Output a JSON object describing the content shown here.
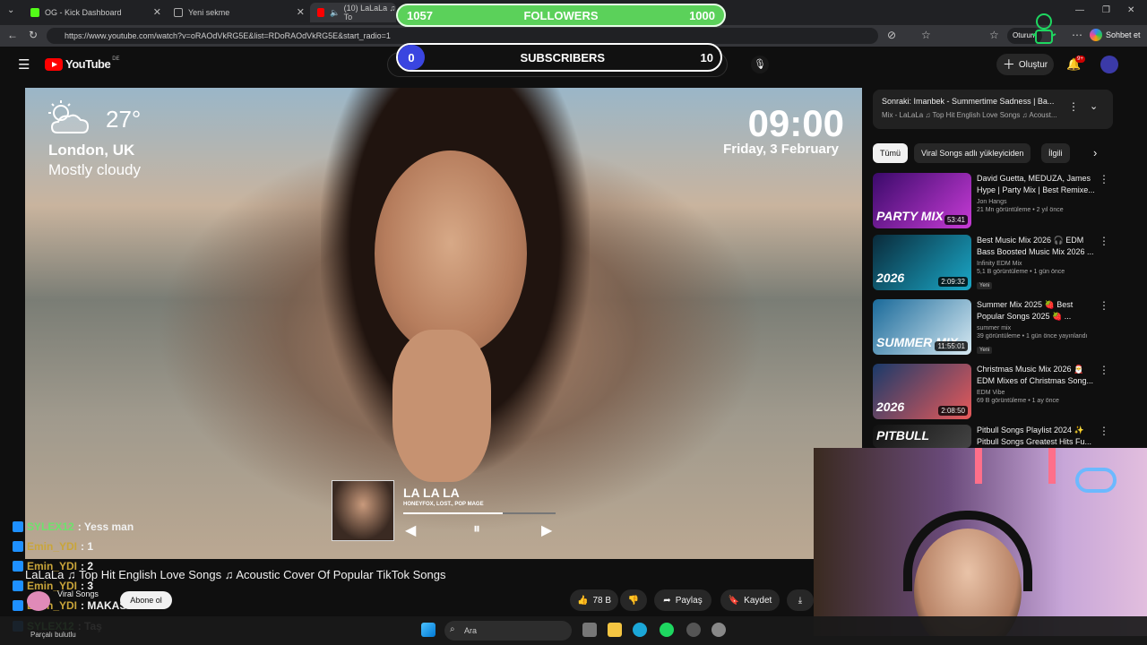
{
  "browser": {
    "tabs": [
      {
        "label": "OG - Kick Dashboard",
        "active": false
      },
      {
        "label": "Yeni sekme",
        "active": false
      },
      {
        "label": "(10) LaLaLa ♫ To",
        "active": true
      }
    ],
    "url": "https://www.youtube.com/watch?v=oRAOdVkRG5E&list=RDoRAOdVkRG5E&start_radio=1",
    "profile_label": "Oturum",
    "copilot_label": "Sohbet et"
  },
  "overlay": {
    "followers": {
      "current": "1057",
      "label": "FOLLOWERS",
      "goal": "1000"
    },
    "subscribers": {
      "current": "0",
      "label": "SUBSCRIBERS",
      "goal": "10",
      "progress": 0
    }
  },
  "youtube": {
    "logo_word": "YouTube",
    "region": "DE",
    "create_label": "Oluştur",
    "notif_count": "9+"
  },
  "video": {
    "weather": {
      "temp": "27°",
      "city": "London, UK",
      "condition": "Mostly cloudy"
    },
    "clock": {
      "time": "09:00",
      "date": "Friday, 3 February"
    },
    "player": {
      "title": "LA LA LA",
      "artists": "HONEYFOX, LOST., POP MAGE",
      "progress": 0.65
    }
  },
  "video_info": {
    "title": "LaLaLa ♫ Top Hit English Love Songs ♫ Acoustic Cover Of Popular TikTok Songs",
    "channel": "Viral Songs",
    "subscribe_label": "Abone ol",
    "like_count": "78 B",
    "share_label": "Paylaş",
    "save_label": "Kaydet"
  },
  "chat": [
    {
      "user": "SYLEX12",
      "text": ": Yess man"
    },
    {
      "user": "Emin_YDI",
      "text": ": 1"
    },
    {
      "user": "Emin_YDI",
      "text": ": 2"
    },
    {
      "user": "Emin_YDI",
      "text": ": 3"
    },
    {
      "user": "Emin_YDI",
      "text": ": MAKASSS"
    },
    {
      "user": "SYLEX12",
      "text": ": Taş"
    }
  ],
  "sidebar": {
    "next_up": {
      "title": "Sonraki: Imanbek - Summertime Sadness | Ba...",
      "subtitle": "Mix - LaLaLa ♫ Top Hit English Love Songs ♫ Acoust..."
    },
    "chips": [
      "Tümü",
      "Viral Songs adlı yükleyiciden",
      "İlgili"
    ],
    "recommendations": [
      {
        "title": "David Guetta, MEDUZA, James Hype | Party Mix | Best Remixe...",
        "channel": "Jon Hangs",
        "meta": "21 Mn görüntüleme • 2 yıl önce",
        "duration": "53:41",
        "thumb_text": "PARTY MIX",
        "badge": ""
      },
      {
        "title": "Best Music Mix 2026 🎧 EDM Bass Boosted Music Mix 2026 ...",
        "channel": "Infinity EDM Mix",
        "meta": "5,1 B görüntüleme • 1 gün önce",
        "duration": "2:09:32",
        "thumb_text": "2026",
        "badge": "Yeni"
      },
      {
        "title": "Summer Mix 2025 🍓 Best Popular Songs 2025 🍓 ...",
        "channel": "summer mix",
        "meta": "39 görüntüleme • 1 gün önce yayınlandı",
        "duration": "11:55:01",
        "thumb_text": "SUMMER MIX",
        "badge": "Yeni"
      },
      {
        "title": "Christmas Music Mix 2026 🎅 EDM Mixes of Christmas Song...",
        "channel": "EDM Vibe",
        "meta": "69 B görüntüleme • 1 ay önce",
        "duration": "2:08:50",
        "thumb_text": "2026",
        "badge": ""
      },
      {
        "title": "Pitbull Songs Playlist 2024 ✨ Pitbull Songs Greatest Hits Fu...",
        "channel": "",
        "meta": "",
        "duration": "",
        "thumb_text": "PITBULL",
        "badge": ""
      }
    ]
  },
  "taskbar": {
    "search_placeholder": "Ara",
    "status_text": "Parçalı bulutlu"
  }
}
